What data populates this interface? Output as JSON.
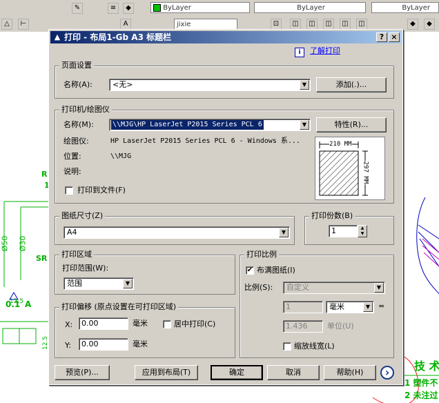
{
  "toolbar": {
    "layer_bylayer_1": "ByLayer",
    "layer_bylayer_2": "ByLayer",
    "layer_bylayer_3": "ByLayer",
    "style_name": "jixie"
  },
  "dialog": {
    "title": "打印 - 布局1-Gb A3 标题栏",
    "help_button": "?",
    "close_button": "×",
    "learn_link": "了解打印",
    "page_setup": {
      "group": "页面设置",
      "name_label": "名称(A):",
      "name_value": "<无>",
      "add_button": "添加(.)..."
    },
    "printer": {
      "group": "打印机/绘图仪",
      "name_label": "名称(M):",
      "name_value": "\\\\MJG\\HP LaserJet P2015 Series PCL 6",
      "properties_button": "特性(R)...",
      "plotter_label": "绘图仪:",
      "plotter_value": "HP LaserJet P2015 Series PCL 6 - Windows 系...",
      "location_label": "位置:",
      "location_value": "\\\\MJG",
      "description_label": "说明:",
      "print_to_file": "打印到文件(F)",
      "preview_width": "210 MM",
      "preview_height": "297 MM"
    },
    "paper": {
      "group": "图纸尺寸(Z)",
      "value": "A4"
    },
    "copies": {
      "group": "打印份数(B)",
      "value": "1"
    },
    "area": {
      "group": "打印区域",
      "range_label": "打印范围(W):",
      "range_value": "范围"
    },
    "offset": {
      "group": "打印偏移 (原点设置在可打印区域)",
      "x_label": "X:",
      "x_value": "0.00",
      "x_unit": "毫米",
      "y_label": "Y:",
      "y_value": "0.00",
      "y_unit": "毫米",
      "center": "居中打印(C)"
    },
    "scale": {
      "group": "打印比例",
      "fit": "布满图纸(I)",
      "fit_checked": "✔",
      "scale_label": "比例(S):",
      "scale_value": "自定义",
      "value1": "1",
      "unit_value": "毫米",
      "equals": "=",
      "value2": "1.436",
      "unit_label": "单位(U)",
      "lineweights": "缩放线宽(L)"
    },
    "buttons": {
      "preview": "预览(P)...",
      "apply": "应用到布局(T)",
      "ok": "确定",
      "cancel": "取消",
      "help": "帮助(H)",
      "expand": "›"
    }
  },
  "canvas": {
    "t1": "R",
    "t2": "1",
    "t3": "Ø50",
    "t4": "Ø30",
    "t5": "SR",
    "t6": "12.5",
    "t7": "0.1",
    "t8": "A",
    "t9": "12.5",
    "t10": "技 术",
    "t11": "1 塑件不",
    "t12": "2 未注过"
  }
}
